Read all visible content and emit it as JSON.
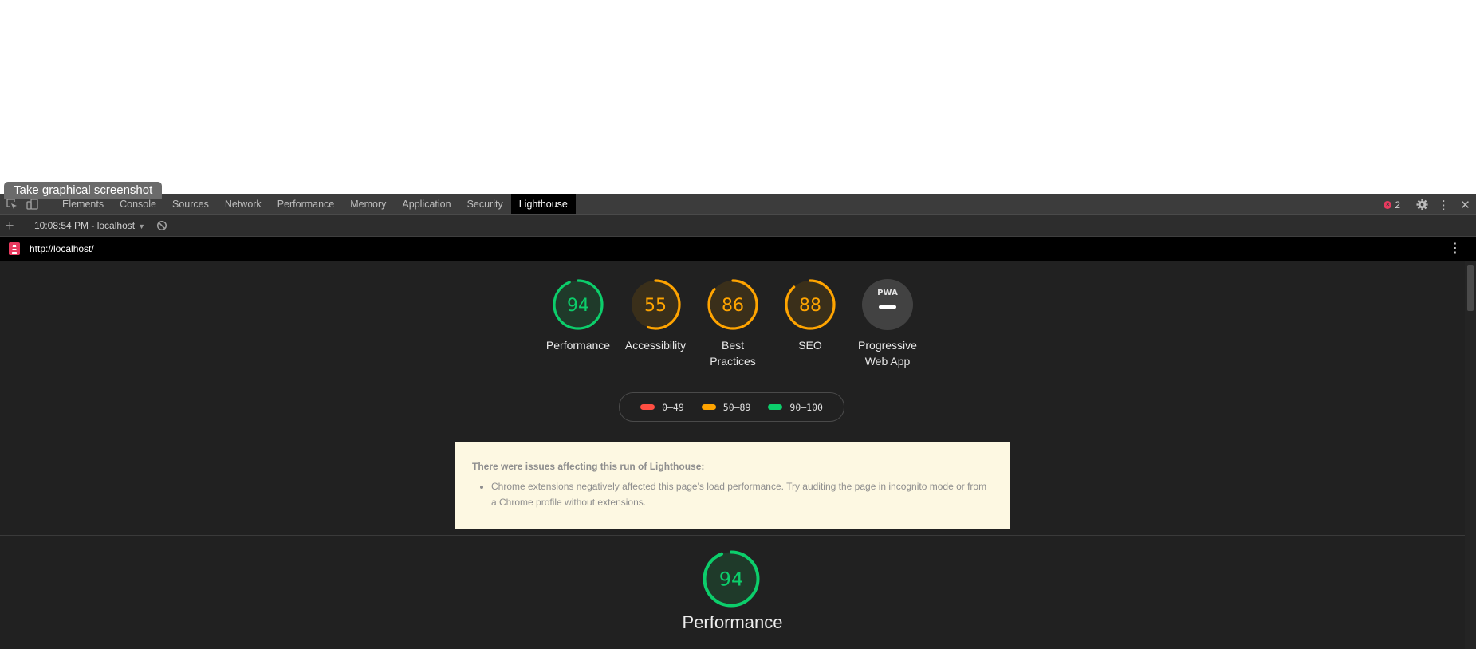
{
  "tooltip": "Take graphical screenshot",
  "tabs": [
    {
      "label": "Elements"
    },
    {
      "label": "Console"
    },
    {
      "label": "Sources"
    },
    {
      "label": "Network"
    },
    {
      "label": "Performance"
    },
    {
      "label": "Memory"
    },
    {
      "label": "Application"
    },
    {
      "label": "Security"
    },
    {
      "label": "Lighthouse",
      "active": true
    }
  ],
  "error_count": "2",
  "toolbar": {
    "run_label": "10:08:54 PM - localhost"
  },
  "url": "http://localhost/",
  "gauges": [
    {
      "score": "94",
      "label_line1": "Performance",
      "label_line2": "",
      "level": 0.94,
      "color": "#0cce6b",
      "bg": "#1f3a2a"
    },
    {
      "score": "55",
      "label_line1": "Accessibility",
      "label_line2": "",
      "level": 0.55,
      "color": "#ffa400",
      "bg": "#3a2f1a"
    },
    {
      "score": "86",
      "label_line1": "Best",
      "label_line2": "Practices",
      "level": 0.86,
      "color": "#ffa400",
      "bg": "#3a2f1a"
    },
    {
      "score": "88",
      "label_line1": "SEO",
      "label_line2": "",
      "level": 0.88,
      "color": "#ffa400",
      "bg": "#3a2f1a"
    }
  ],
  "pwa": {
    "badge_text": "PWA",
    "label_line1": "Progressive",
    "label_line2": "Web App"
  },
  "legend": [
    {
      "range": "0–49",
      "color": "#ff4e42"
    },
    {
      "range": "50–89",
      "color": "#ffa400"
    },
    {
      "range": "90–100",
      "color": "#0cce6b"
    }
  ],
  "warning": {
    "title": "There were issues affecting this run of Lighthouse:",
    "items": [
      "Chrome extensions negatively affected this page's load performance. Try auditing the page in incognito mode or from a Chrome profile without extensions."
    ]
  },
  "performance_section": {
    "score": "94",
    "title": "Performance",
    "level": 0.94,
    "color": "#0cce6b",
    "bg": "#1f3a2a"
  }
}
